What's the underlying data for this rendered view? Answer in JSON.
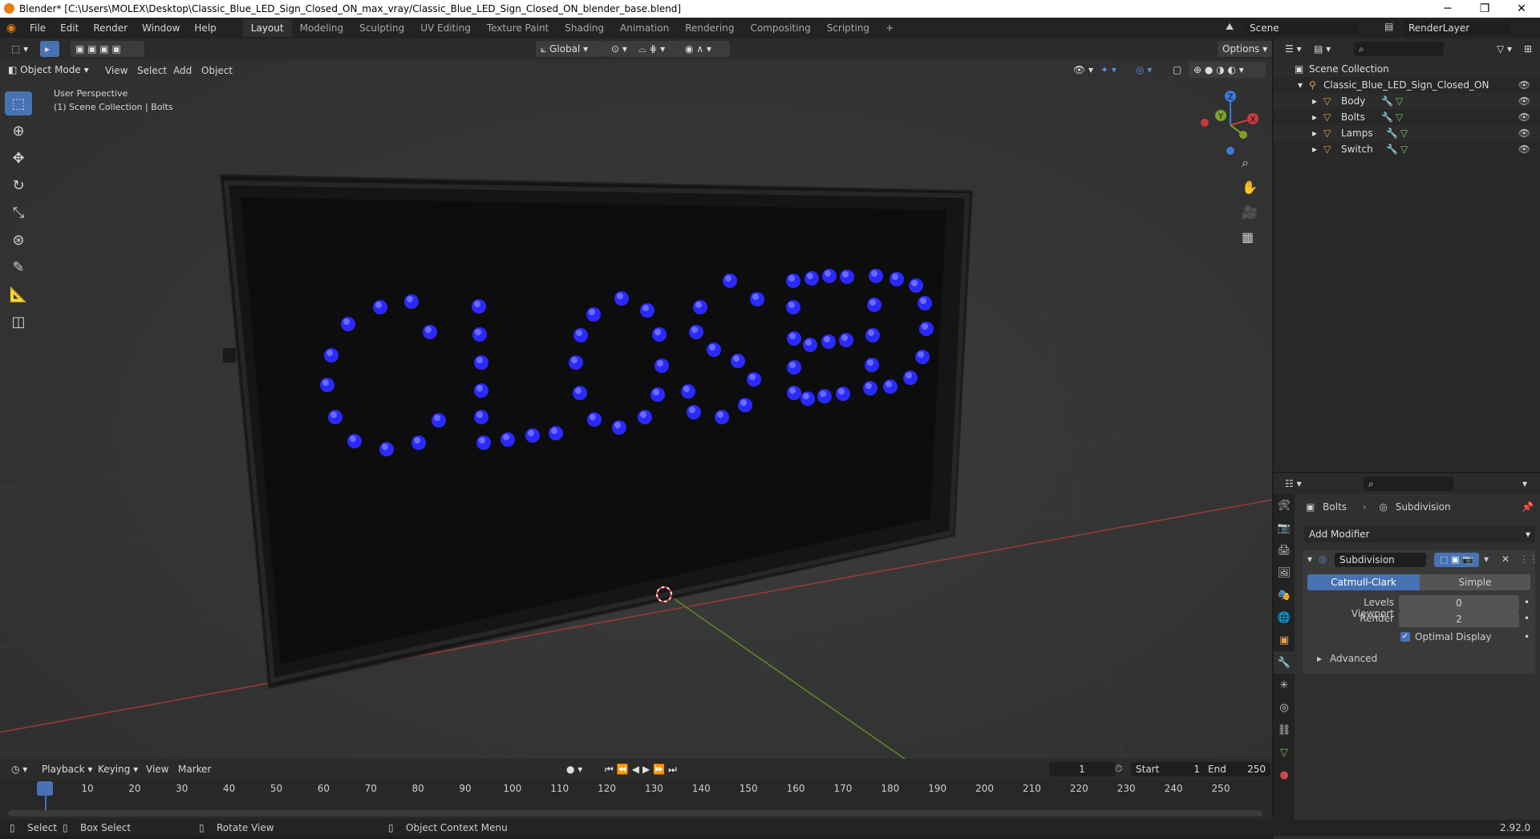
{
  "window": {
    "title": "Blender* [C:\\Users\\MOLEX\\Desktop\\Classic_Blue_LED_Sign_Closed_ON_max_vray/Classic_Blue_LED_Sign_Closed_ON_blender_base.blend]",
    "min": "─",
    "max": "❐",
    "close": "✕"
  },
  "menu": [
    "File",
    "Edit",
    "Render",
    "Window",
    "Help"
  ],
  "workspaces": [
    "Layout",
    "Modeling",
    "Sculpting",
    "UV Editing",
    "Texture Paint",
    "Shading",
    "Animation",
    "Rendering",
    "Compositing",
    "Scripting"
  ],
  "active_workspace": "Layout",
  "add_workspace": "+",
  "scene": {
    "name": "Scene",
    "render_layer": "RenderLayer"
  },
  "viewport_header": {
    "transform_orientation": "Global",
    "options": "Options",
    "mode": "Object Mode",
    "menus": [
      "View",
      "Select",
      "Add",
      "Object"
    ]
  },
  "viewport": {
    "perspective": "User Perspective",
    "collection_info": "(1) Scene Collection | Bolts",
    "axis_x": "X",
    "axis_y": "Y",
    "axis_z": "Z"
  },
  "outliner": {
    "root": "Scene Collection",
    "collection": "Classic_Blue_LED_Sign_Closed_ON",
    "objects": [
      "Body",
      "Bolts",
      "Lamps",
      "Switch"
    ]
  },
  "properties": {
    "object": "Bolts",
    "modifier_context": "Subdivision",
    "add_modifier": "Add Modifier",
    "modifier": {
      "name": "Subdivision",
      "type_options": [
        "Catmull-Clark",
        "Simple"
      ],
      "selected_type": "Catmull-Clark",
      "levels_viewport_label": "Levels Viewport",
      "levels_viewport": "0",
      "render_label": "Render",
      "render": "2",
      "optimal_display_label": "Optimal Display",
      "optimal_display": true,
      "advanced": "Advanced"
    }
  },
  "timeline": {
    "menus": [
      "Playback",
      "Keying",
      "View",
      "Marker"
    ],
    "current_frame": "1",
    "start_label": "Start",
    "start": "1",
    "end_label": "End",
    "end": "250",
    "ticks": [
      "1",
      "10",
      "20",
      "30",
      "40",
      "50",
      "60",
      "70",
      "80",
      "90",
      "100",
      "110",
      "120",
      "130",
      "140",
      "150",
      "160",
      "170",
      "180",
      "190",
      "200",
      "210",
      "220",
      "230",
      "240",
      "250"
    ]
  },
  "statusbar": {
    "select": "Select",
    "box_select": "Box Select",
    "rotate_view": "Rotate View",
    "context_menu": "Object Context Menu",
    "version": "2.92.0"
  },
  "colors": {
    "accent": "#4772b3",
    "led": "#2a2aff",
    "x_axis": "#c93b3b",
    "y_axis": "#7aa12a",
    "z_axis": "#3b7bd8"
  }
}
